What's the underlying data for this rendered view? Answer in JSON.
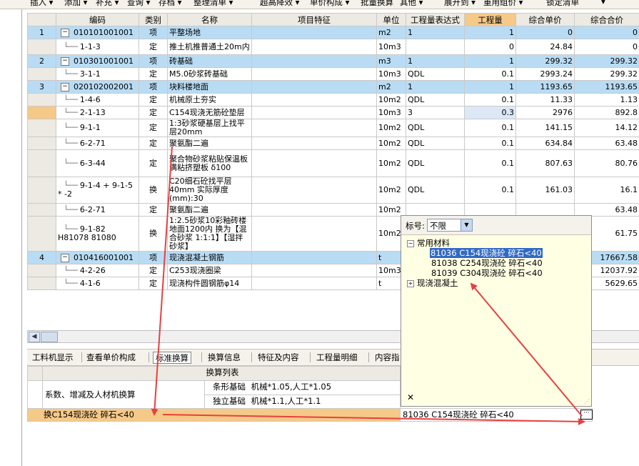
{
  "toolbar": {
    "items": [
      "插入 ▾",
      "添加 ▾",
      "补充 ▾",
      "查询 ▾",
      "存档 ▾",
      "整理清单 ▾",
      "超高降效 ▾",
      "单价构成 ▾",
      "批量换算",
      "其他 ▾",
      "展开到 ▾",
      "重用组价 ▾",
      "锁定清单",
      "▾"
    ]
  },
  "grid": {
    "headers": [
      "编码",
      "类别",
      "名称",
      "项目特征",
      "单位",
      "工程量表达式",
      "工程量",
      "综合单价",
      "综合合价"
    ],
    "rows": [
      {
        "num": "1",
        "tree": "−",
        "code": "010101001001",
        "type": "项",
        "name": "平整场地",
        "unit": "m2",
        "expr": "1",
        "qty": "1",
        "price": "0",
        "total": "0",
        "kind": "item"
      },
      {
        "num": "",
        "code": "1-1-3",
        "type": "定",
        "name": "推土机推普通土20m内",
        "unit": "10m3",
        "expr": "",
        "qty": "0",
        "price": "24.84",
        "total": "0",
        "kind": "sub"
      },
      {
        "num": "2",
        "tree": "−",
        "code": "010301001001",
        "type": "项",
        "name": "砖基础",
        "unit": "m3",
        "expr": "1",
        "qty": "1",
        "price": "299.32",
        "total": "299.32",
        "kind": "item"
      },
      {
        "num": "",
        "code": "3-1-1",
        "type": "定",
        "name": "M5.0砂浆砖基础",
        "unit": "10m3",
        "expr": "QDL",
        "qty": "0.1",
        "price": "2993.24",
        "total": "299.32",
        "kind": "sub"
      },
      {
        "num": "3",
        "tree": "−",
        "code": "020102002001",
        "type": "项",
        "name": "块料楼地面",
        "unit": "m2",
        "expr": "1",
        "qty": "1",
        "price": "1193.65",
        "total": "1193.65",
        "kind": "item"
      },
      {
        "num": "",
        "code": "1-4-6",
        "type": "定",
        "name": "机械原土夯实",
        "unit": "10m2",
        "expr": "QDL",
        "qty": "0.1",
        "price": "11.33",
        "total": "1.13",
        "kind": "sub"
      },
      {
        "num": "",
        "code": "2-1-13",
        "type": "定",
        "name": "C154现浇无筋砼垫层",
        "unit": "10m3",
        "expr": "3",
        "qty": "0.3",
        "price": "2976",
        "total": "892.8",
        "kind": "sel"
      },
      {
        "num": "",
        "code": "9-1-1",
        "type": "定",
        "name": "1:3砂浆硬基层上找平层20mm",
        "unit": "10m2",
        "expr": "QDL",
        "qty": "0.1",
        "price": "141.15",
        "total": "14.12",
        "kind": "sub"
      },
      {
        "num": "",
        "code": "6-2-71",
        "type": "定",
        "name": "聚氨酯二遍",
        "unit": "10m2",
        "expr": "QDL",
        "qty": "0.1",
        "price": "634.84",
        "total": "63.48",
        "kind": "sub"
      },
      {
        "num": "",
        "code": "6-3-44",
        "type": "定",
        "name": "聚合物砂浆粘贴保温板 满粘挤塑板 δ100",
        "unit": "10m2",
        "expr": "QDL",
        "qty": "0.1",
        "price": "807.63",
        "total": "80.76",
        "kind": "sub"
      },
      {
        "num": "",
        "code": "9-1-4 + 9-1-5 * -2",
        "type": "换",
        "name": "C20细石砼找平层40mm 实际厚度(mm):30",
        "unit": "10m2",
        "expr": "QDL",
        "qty": "0.1",
        "price": "161.03",
        "total": "16.1",
        "kind": "sub"
      },
      {
        "num": "",
        "code": "6-2-71",
        "type": "定",
        "name": "聚氨酯二遍",
        "unit": "10m2",
        "expr": "",
        "qty": "",
        "price": "",
        "total": "63.48",
        "kind": "sub"
      },
      {
        "num": "",
        "code": "9-1-82 H81078 81080",
        "type": "换",
        "name": "1:2.5砂浆10彩釉砖楼地面1200内 换为【混合砂浆 1:1:1】【湿拌砂浆】",
        "unit": "10m2",
        "expr": "",
        "qty": "",
        "price": "",
        "total": "61.75",
        "kind": "sub"
      },
      {
        "num": "4",
        "tree": "−",
        "code": "010416001001",
        "type": "项",
        "name": "现浇混凝土钢筋",
        "unit": "t",
        "expr": "",
        "qty": "",
        "price": "",
        "total": "17667.58",
        "kind": "item"
      },
      {
        "num": "",
        "code": "4-2-26",
        "type": "定",
        "name": "C253现浇圈梁",
        "unit": "10m3",
        "expr": "",
        "qty": "",
        "price": "",
        "total": "12037.92",
        "kind": "sub"
      },
      {
        "num": "",
        "code": "4-1-6",
        "type": "定",
        "name": "现浇构件圆钢筋φ14",
        "unit": "t",
        "expr": "",
        "qty": "",
        "price": "",
        "total": "5629.65",
        "kind": "sub"
      }
    ]
  },
  "tabs": [
    "工料机显示",
    "查看单价构成",
    "标准换算",
    "换算信息",
    "特征及内容",
    "工程量明细",
    "内容指"
  ],
  "lower": {
    "header": "换算列表",
    "group_label": "系数、增减及人材机换算",
    "sub1_name": "条形基础",
    "sub1_value": "机械*1.05,人工*1.05",
    "sub2_name": "独立基础",
    "sub2_value": "机械*1.1,人工*1.1",
    "sel_label": "换C154现浇砼 碎石<40",
    "sel_value": "81036  C154现浇砼 碎石<40"
  },
  "popup": {
    "filter_label": "标号:",
    "filter_value": "不限",
    "group1": "常用材料",
    "items": [
      "81036  C154现浇砼 碎石<40",
      "81038  C254现浇砼 碎石<40",
      "81039  C304现浇砼 碎石<40"
    ],
    "group2": "现浇混凝土",
    "close": "✕",
    "ellipsis": "···"
  },
  "colors": {
    "annotation": "#e84040",
    "highlight": "#f5c988",
    "item_row": "#b9dcf4",
    "popup_bg": "#ffffe4"
  }
}
